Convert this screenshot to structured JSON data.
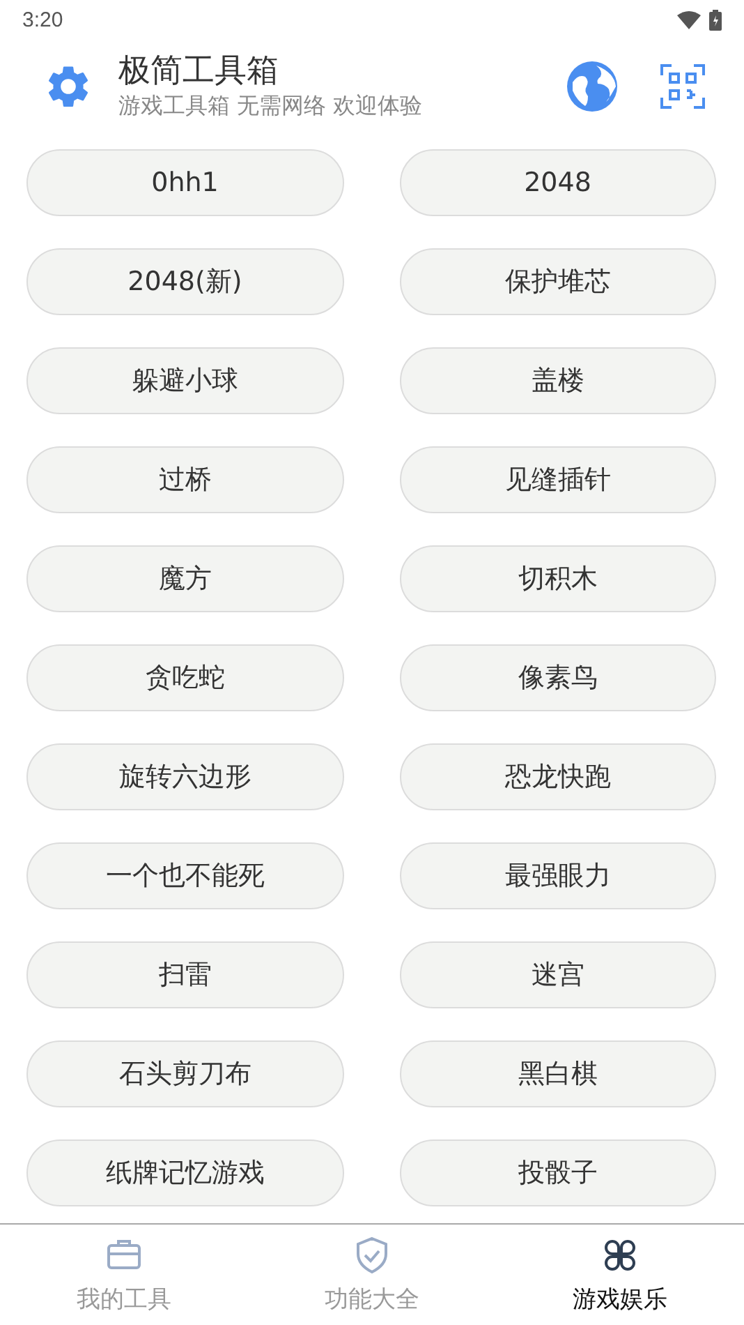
{
  "status_bar": {
    "time": "3:20"
  },
  "header": {
    "title": "极简工具箱",
    "subtitle": "游戏工具箱 无需网络 欢迎体验"
  },
  "games": [
    "0hh1",
    "2048",
    "2048(新)",
    "保护堆芯",
    "躲避小球",
    "盖楼",
    "过桥",
    "见缝插针",
    "魔方",
    "切积木",
    "贪吃蛇",
    "像素鸟",
    "旋转六边形",
    "恐龙快跑",
    "一个也不能死",
    "最强眼力",
    "扫雷",
    "迷宫",
    "石头剪刀布",
    "黑白棋",
    "纸牌记忆游戏",
    "投骰子"
  ],
  "tabs": [
    {
      "label": "我的工具",
      "selected": false
    },
    {
      "label": "功能大全",
      "selected": false
    },
    {
      "label": "游戏娱乐",
      "selected": true
    }
  ]
}
